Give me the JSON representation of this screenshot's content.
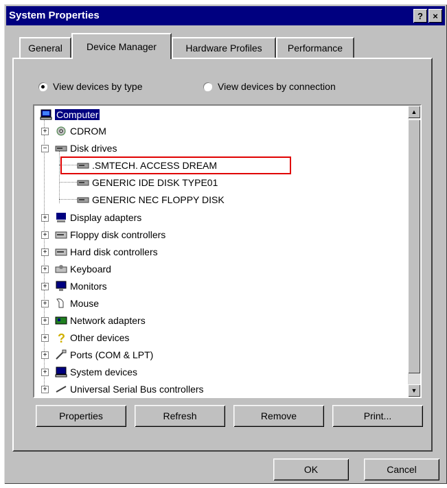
{
  "window": {
    "title": "System Properties",
    "help_label": "?",
    "close_label": "×"
  },
  "tabs": [
    {
      "label": "General",
      "active": false
    },
    {
      "label": "Device Manager",
      "active": true
    },
    {
      "label": "Hardware Profiles",
      "active": false
    },
    {
      "label": "Performance",
      "active": false
    }
  ],
  "view_options": {
    "by_type": "View devices by type",
    "by_connection": "View devices by connection",
    "selected": "by_type"
  },
  "tree": {
    "root": "Computer",
    "items": [
      {
        "label": "CDROM",
        "icon": "cdrom-icon",
        "expanded": false
      },
      {
        "label": "Disk drives",
        "icon": "disk-drive-icon",
        "expanded": true,
        "children": [
          ".SMTECH. ACCESS DREAM",
          "GENERIC IDE  DISK TYPE01",
          "GENERIC NEC  FLOPPY DISK"
        ]
      },
      {
        "label": "Display adapters",
        "icon": "display-adapter-icon",
        "expanded": false
      },
      {
        "label": "Floppy disk controllers",
        "icon": "floppy-controller-icon",
        "expanded": false
      },
      {
        "label": "Hard disk controllers",
        "icon": "hard-disk-controller-icon",
        "expanded": false
      },
      {
        "label": "Keyboard",
        "icon": "keyboard-icon",
        "expanded": false
      },
      {
        "label": "Monitors",
        "icon": "monitor-icon",
        "expanded": false
      },
      {
        "label": "Mouse",
        "icon": "mouse-icon",
        "expanded": false
      },
      {
        "label": "Network adapters",
        "icon": "network-adapter-icon",
        "expanded": false
      },
      {
        "label": "Other devices",
        "icon": "question-icon",
        "expanded": false
      },
      {
        "label": "Ports (COM & LPT)",
        "icon": "port-icon",
        "expanded": false
      },
      {
        "label": "System devices",
        "icon": "system-device-icon",
        "expanded": false
      },
      {
        "label": "Universal Serial Bus controllers",
        "icon": "usb-icon",
        "expanded": false
      }
    ]
  },
  "buttons": {
    "properties": "Properties",
    "refresh": "Refresh",
    "remove": "Remove",
    "print": "Print...",
    "ok": "OK",
    "cancel": "Cancel"
  },
  "colors": {
    "titlebar": "#000080",
    "face": "#c0c0c0",
    "selection": "#000080",
    "annotation": "#e00000"
  }
}
